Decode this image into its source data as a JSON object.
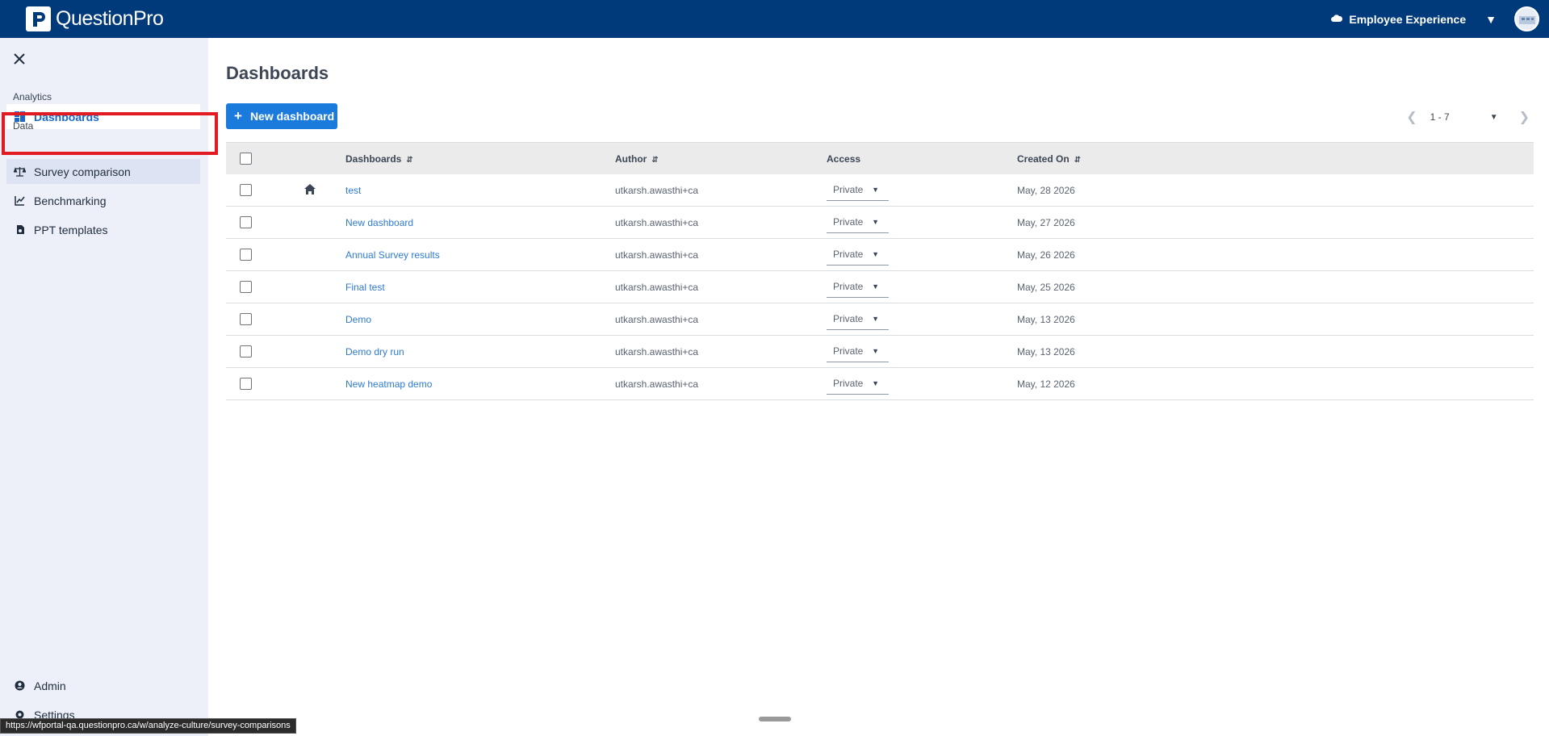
{
  "app": {
    "logo_text": "QuestionPro",
    "product_switch": "Employee Experience"
  },
  "sidebar": {
    "sections": [
      {
        "label": "Analytics"
      },
      {
        "label": "Data"
      }
    ],
    "items": [
      {
        "label": "Dashboards",
        "icon": "dashboard-icon",
        "active": true
      },
      {
        "label": "Survey comparison",
        "icon": "scale-icon"
      },
      {
        "label": "Benchmarking",
        "icon": "line-chart-icon"
      },
      {
        "label": "PPT templates",
        "icon": "ppt-icon"
      }
    ],
    "bottom_items": [
      {
        "label": "Admin",
        "icon": "admin-icon"
      },
      {
        "label": "Settings",
        "icon": "settings-icon"
      }
    ]
  },
  "main": {
    "title": "Dashboards",
    "new_button_label": "New dashboard",
    "pager": {
      "range": "1 - 7"
    },
    "table": {
      "headers": {
        "name": "Dashboards",
        "author": "Author",
        "access": "Access",
        "created": "Created On"
      },
      "rows": [
        {
          "name": "test",
          "author": "utkarsh.awasthi+ca",
          "access": "Private",
          "created": "May, 28 2026",
          "home": true
        },
        {
          "name": "New dashboard",
          "author": "utkarsh.awasthi+ca",
          "access": "Private",
          "created": "May, 27 2026"
        },
        {
          "name": "Annual Survey results",
          "author": "utkarsh.awasthi+ca",
          "access": "Private",
          "created": "May, 26 2026"
        },
        {
          "name": "Final test",
          "author": "utkarsh.awasthi+ca",
          "access": "Private",
          "created": "May, 25 2026"
        },
        {
          "name": "Demo",
          "author": "utkarsh.awasthi+ca",
          "access": "Private",
          "created": "May, 13 2026"
        },
        {
          "name": "Demo dry run",
          "author": "utkarsh.awasthi+ca",
          "access": "Private",
          "created": "May, 13 2026"
        },
        {
          "name": "New heatmap demo",
          "author": "utkarsh.awasthi+ca",
          "access": "Private",
          "created": "May, 12 2026"
        }
      ]
    }
  },
  "status_bar": {
    "url": "https://wfportal-qa.questionpro.ca/w/analyze-culture/survey-comparisons"
  },
  "colors": {
    "topbar": "#003a7a",
    "accent": "#1b7bdc",
    "highlight": "#e21b23",
    "sidebar": "#edf0f9"
  }
}
